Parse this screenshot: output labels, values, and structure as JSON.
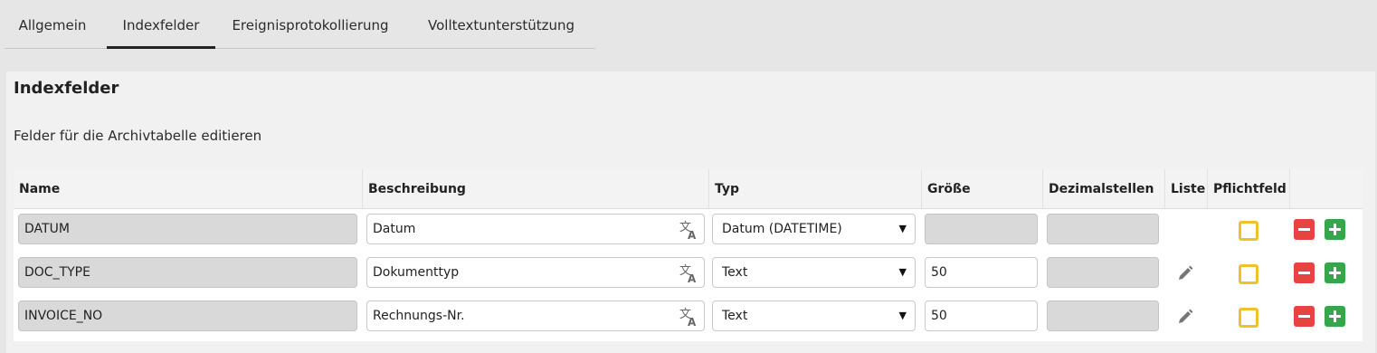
{
  "tabs": [
    {
      "label": "Allgemein",
      "active": false
    },
    {
      "label": "Indexfelder",
      "active": true
    },
    {
      "label": "Ereignisprotokollierung",
      "active": false
    },
    {
      "label": "Volltextunterstützung",
      "active": false
    }
  ],
  "panel": {
    "title": "Indexfelder",
    "subtitle": "Felder für die Archivtabelle editieren"
  },
  "table": {
    "headers": [
      "Name",
      "Beschreibung",
      "Typ",
      "Größe",
      "Dezimalstellen",
      "Liste",
      "Pflichtfeld",
      ""
    ],
    "rows": [
      {
        "name": "DATUM",
        "description": "Datum",
        "type": "Datum (DATETIME)",
        "size": "",
        "decimals": "",
        "has_list": false,
        "required": false
      },
      {
        "name": "DOC_TYPE",
        "description": "Dokumenttyp",
        "type": "Text",
        "size": "50",
        "decimals": "",
        "has_list": true,
        "required": false
      },
      {
        "name": "INVOICE_NO",
        "description": "Rechnungs-Nr.",
        "type": "Text",
        "size": "50",
        "decimals": "",
        "has_list": true,
        "required": false
      }
    ]
  },
  "icons": {
    "translate": "translate-icon",
    "list_edit": "pencil-icon",
    "remove": "minus-icon",
    "add": "plus-icon",
    "dropdown": "caret-down-icon"
  },
  "colors": {
    "remove": "#e84343",
    "add": "#35a64a",
    "checkbox_border": "#f0c12c",
    "disabled_field": "#d9d9d9"
  }
}
